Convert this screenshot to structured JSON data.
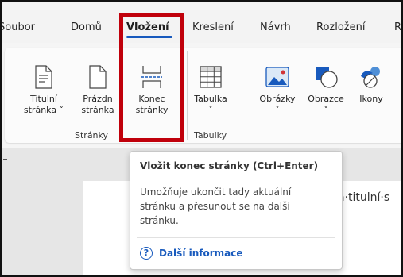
{
  "tabs": [
    {
      "label": "Soubor"
    },
    {
      "label": "Domů"
    },
    {
      "label": "Vložení"
    },
    {
      "label": "Kreslení"
    },
    {
      "label": "Návrh"
    },
    {
      "label": "Rozložení"
    },
    {
      "label": "R"
    }
  ],
  "ribbon": {
    "pages_group": {
      "label": "Stránky",
      "buttons": [
        {
          "line1": "Titulní",
          "line2": "stránka ˅",
          "icon": "cover-page-icon"
        },
        {
          "line1": "Prázdn",
          "line2": "stránka",
          "icon": "blank-page-icon"
        },
        {
          "line1": "Konec",
          "line2": "stránky",
          "icon": "page-break-icon"
        }
      ]
    },
    "tables_group": {
      "label": "Tabulky",
      "buttons": [
        {
          "line1": "Tabulka",
          "line2": "˅",
          "icon": "table-icon"
        }
      ]
    },
    "illustrations": [
      {
        "line1": "Obrázky",
        "line2": "˅",
        "icon": "pictures-icon"
      },
      {
        "line1": "Obrazce",
        "line2": "˅",
        "icon": "shapes-icon"
      },
      {
        "line1": "Ikony",
        "line2": "",
        "icon": "icons-icon"
      }
    ]
  },
  "document": {
    "visible_text": "a·titulní·s"
  },
  "tooltip": {
    "title": "Vložit konec stránky (Ctrl+Enter)",
    "body": "Umožňuje ukončit tady aktuální stránku a přesunout se na další stránku.",
    "help_icon_glyph": "?",
    "help_label": "Další informace"
  },
  "colors": {
    "accent_blue": "#185abd",
    "highlight_red": "#c0000b"
  }
}
